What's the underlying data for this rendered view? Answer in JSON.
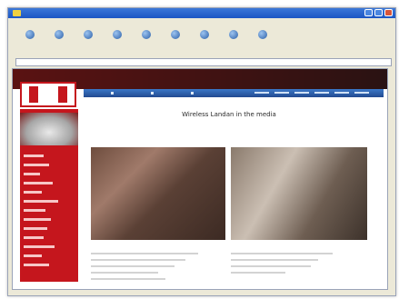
{
  "browser": {
    "title": "",
    "menu": [
      "",
      "",
      "",
      "",
      "",
      "",
      ""
    ],
    "toolbar": [
      "",
      "",
      "",
      "",
      "",
      "",
      "",
      "",
      ""
    ],
    "address": {
      "label": "",
      "go": ""
    },
    "status": {
      "text": "",
      "zone": ""
    }
  },
  "page": {
    "title": "Wireless Landan in the media"
  },
  "colors": {
    "brand_red": "#c5161d",
    "nav_blue": "#2f63b6"
  },
  "icons": [
    "app-icon",
    "toolbar-icon",
    "close-icon"
  ]
}
